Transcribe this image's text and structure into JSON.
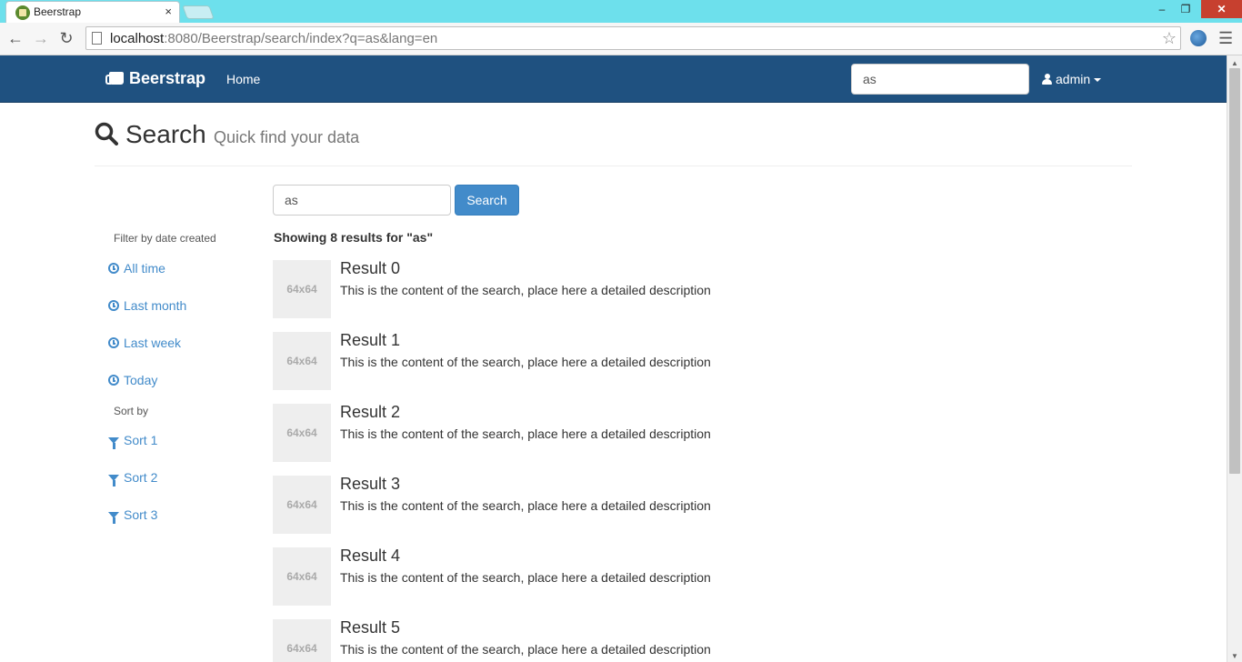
{
  "browser": {
    "tab_title": "Beerstrap",
    "tab_close": "×",
    "url_host": "localhost",
    "url_rest": ":8080/Beerstrap/search/index?q=as&lang=en",
    "window_min": "–",
    "window_max": "❐",
    "window_close": "✕"
  },
  "navbar": {
    "brand": "Beerstrap",
    "home": "Home",
    "search_value": "as",
    "user": "admin"
  },
  "header": {
    "title": "Search",
    "subtitle": "Quick find your data"
  },
  "sidebar": {
    "date_heading": "Filter by date created",
    "date_filters": [
      "All time",
      "Last month",
      "Last week",
      "Today"
    ],
    "sort_heading": "Sort by",
    "sorts": [
      "Sort 1",
      "Sort 2",
      "Sort 3"
    ]
  },
  "main": {
    "search_value": "as",
    "search_button": "Search",
    "summary": "Showing 8 results for \"as\"",
    "results": [
      {
        "thumb": "64x64",
        "title": "Result 0",
        "desc": "This is the content of the search, place here a detailed description"
      },
      {
        "thumb": "64x64",
        "title": "Result 1",
        "desc": "This is the content of the search, place here a detailed description"
      },
      {
        "thumb": "64x64",
        "title": "Result 2",
        "desc": "This is the content of the search, place here a detailed description"
      },
      {
        "thumb": "64x64",
        "title": "Result 3",
        "desc": "This is the content of the search, place here a detailed description"
      },
      {
        "thumb": "64x64",
        "title": "Result 4",
        "desc": "This is the content of the search, place here a detailed description"
      },
      {
        "thumb": "64x64",
        "title": "Result 5",
        "desc": "This is the content of the search, place here a detailed description"
      }
    ]
  },
  "colors": {
    "navbar": "#1f5180",
    "link": "#428bca",
    "tabbar": "#6de0ec"
  }
}
